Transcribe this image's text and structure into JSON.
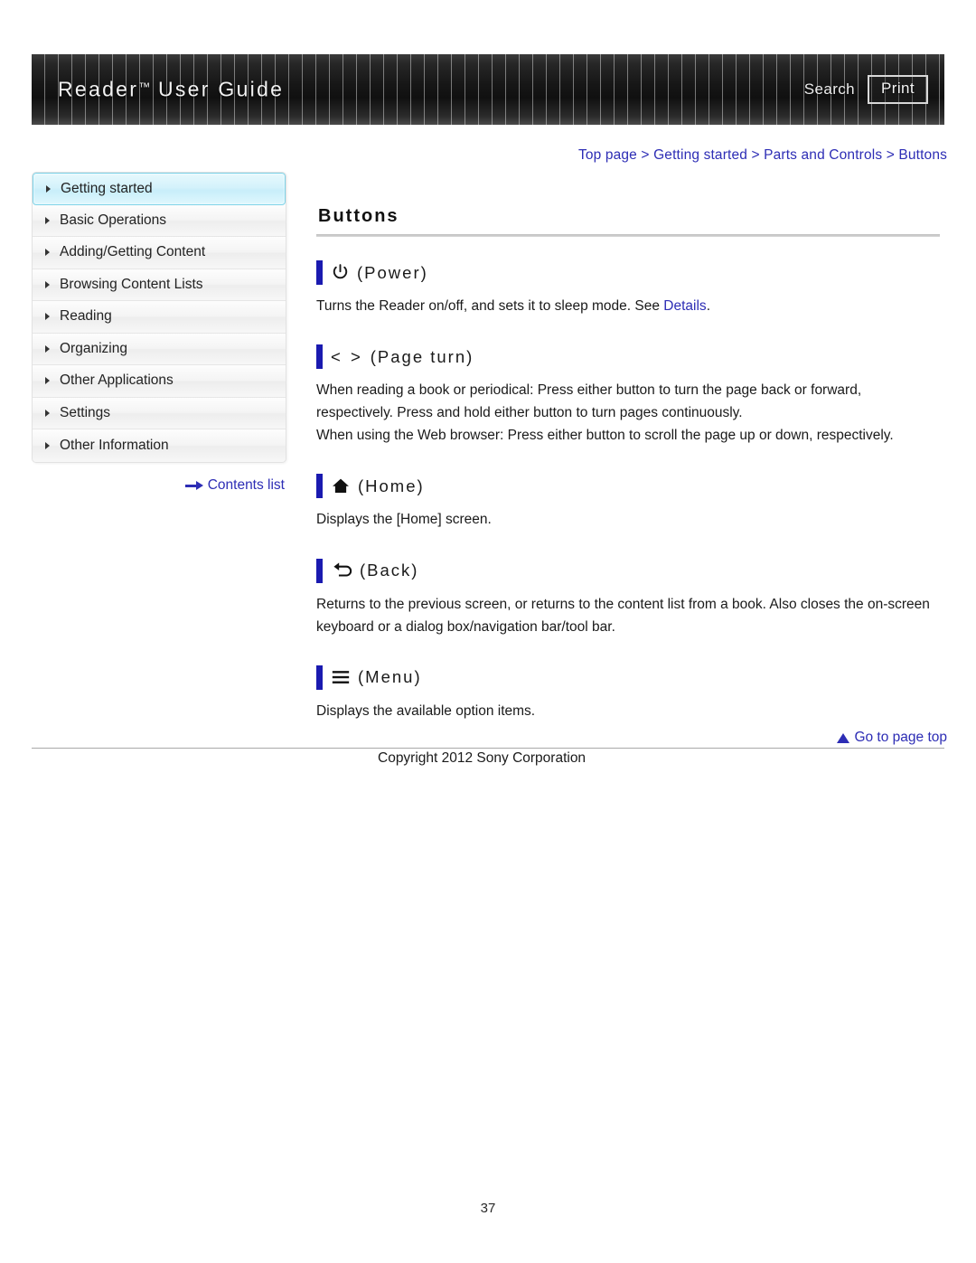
{
  "header": {
    "title": "Reader",
    "trademark": "™",
    "title_suffix": " User Guide",
    "search_label": "Search",
    "print_label": "Print"
  },
  "breadcrumb": {
    "items": [
      "Top page",
      "Getting started",
      "Parts and Controls",
      "Buttons"
    ],
    "separator": ">",
    "full_text": "Top page > Getting started > Parts and Controls > Buttons"
  },
  "sidebar": {
    "items": [
      {
        "label": "Getting started",
        "active": true
      },
      {
        "label": "Basic Operations",
        "active": false
      },
      {
        "label": "Adding/Getting Content",
        "active": false
      },
      {
        "label": "Browsing Content Lists",
        "active": false
      },
      {
        "label": "Reading",
        "active": false
      },
      {
        "label": "Organizing",
        "active": false
      },
      {
        "label": "Other Applications",
        "active": false
      },
      {
        "label": "Settings",
        "active": false
      },
      {
        "label": "Other Information",
        "active": false
      }
    ],
    "contents_list_label": "Contents list"
  },
  "main": {
    "page_title": "Buttons",
    "sections": [
      {
        "icon": "power-icon",
        "label": "(Power)",
        "body": "Turns the Reader on/off, and sets it to sleep mode. See ",
        "link": "Details",
        "body_tail": "."
      },
      {
        "icon": "page-turn-icon",
        "glyph": "< >",
        "label": "(Page turn)",
        "body_line1": "When reading a book or periodical: Press either button to turn the page back or forward, respectively. Press and hold either button to turn pages continuously.",
        "body_line2": "When using the Web browser: Press either button to scroll the page up or down, respectively."
      },
      {
        "icon": "home-icon",
        "label": "(Home)",
        "body": "Displays the [Home] screen."
      },
      {
        "icon": "back-icon",
        "label": "(Back)",
        "body": "Returns to the previous screen, or returns to the content list from a book. Also closes the on-screen keyboard or a dialog box/navigation bar/tool bar."
      },
      {
        "icon": "menu-icon",
        "label": "(Menu)",
        "body": "Displays the available option items."
      }
    ]
  },
  "footer": {
    "go_to_top_label": "Go to page top",
    "copyright": "Copyright 2012 Sony Corporation",
    "page_number": "37"
  },
  "colors": {
    "link": "#2d2db5",
    "marker": "#1a1ab0",
    "active_nav": "#c8eefa",
    "header_dark": "#171717"
  }
}
